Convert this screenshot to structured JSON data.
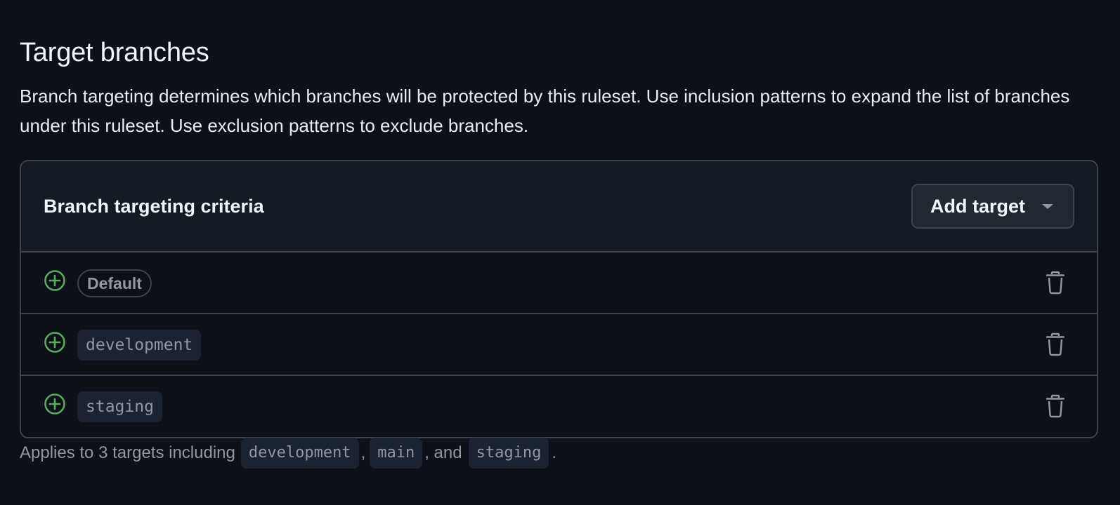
{
  "section": {
    "title": "Target branches",
    "description": "Branch targeting determines which branches will be protected by this ruleset. Use inclusion patterns to expand the list of branches under this ruleset. Use exclusion patterns to exclude branches."
  },
  "criteria": {
    "header": "Branch targeting criteria",
    "add_button": "Add target",
    "rows": [
      {
        "label": "Default",
        "kind": "badge",
        "icon": "plus-circle-icon"
      },
      {
        "label": "development",
        "kind": "code",
        "icon": "plus-circle-icon"
      },
      {
        "label": "staging",
        "kind": "code",
        "icon": "plus-circle-icon"
      }
    ]
  },
  "footer": {
    "prefix": "Applies to 3 targets including",
    "targets": [
      "development",
      "main",
      "staging"
    ],
    "comma1": ",",
    "comma2": ", and",
    "end": "."
  },
  "colors": {
    "background": "#0d1117",
    "header_bg": "#151b23",
    "border": "#3d444d",
    "include_green": "#57ab5a",
    "muted": "#9198a1"
  }
}
